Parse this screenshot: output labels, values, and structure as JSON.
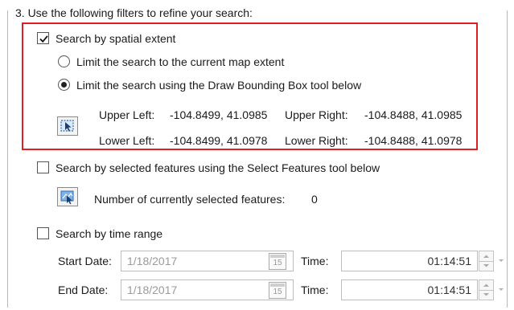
{
  "header": {
    "text": "3. Use the following filters to refine your search:"
  },
  "spatial": {
    "checkbox_label": "Search by spatial extent",
    "checked": true,
    "radio_current_label": "Limit the search to the current map extent",
    "radio_bbox_label": "Limit the search using the Draw Bounding Box tool below",
    "selected_option": "bbox",
    "draw_tool_icon": "draw-bounding-box-icon",
    "upper_left_label": "Upper Left:",
    "upper_left_value": "-104.8499, 41.0985",
    "upper_right_label": "Upper Right:",
    "upper_right_value": "-104.8488, 41.0985",
    "lower_left_label": "Lower Left:",
    "lower_left_value": "-104.8499, 41.0978",
    "lower_right_label": "Lower Right:",
    "lower_right_value": "-104.8488, 41.0978"
  },
  "selected": {
    "checkbox_label": "Search by selected features using the Select Features tool below",
    "checked": false,
    "select_tool_icon": "select-features-icon",
    "count_label": "Number of currently selected features:",
    "count_value": "0"
  },
  "time": {
    "checkbox_label": "Search by time range",
    "checked": false,
    "start_label": "Start Date:",
    "start_date": "1/18/2017",
    "end_label": "End Date:",
    "end_date": "1/18/2017",
    "calendar_day": "15",
    "time_label": "Time:",
    "start_time": "01:14:51",
    "end_time": "01:14:51"
  },
  "colors": {
    "highlight_border": "#e02020",
    "disabled_text": "#9a9a9a"
  }
}
